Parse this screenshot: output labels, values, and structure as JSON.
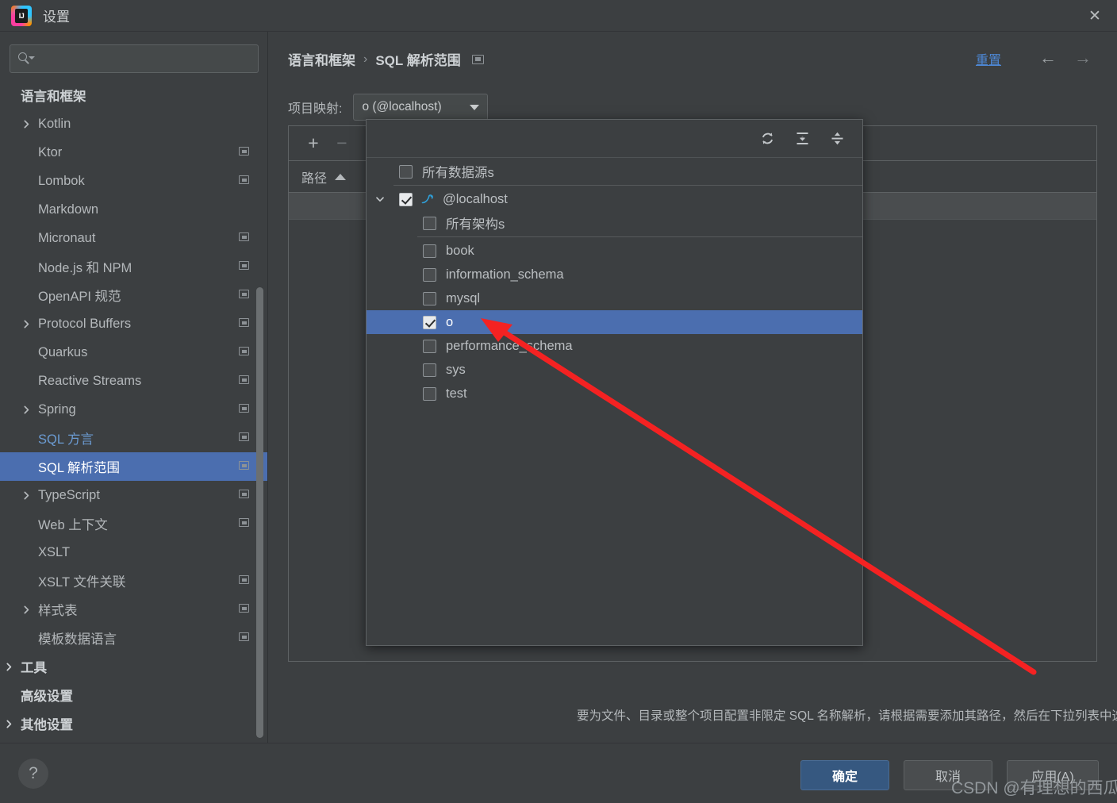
{
  "window": {
    "title": "设置",
    "logo_text": "IJ",
    "close_label": "✕"
  },
  "sidebar": {
    "search": {
      "value": "",
      "placeholder": ""
    },
    "items": [
      {
        "label": "语言和框架",
        "indent": 0,
        "heading": true,
        "chevron": "none",
        "badge": false,
        "selected": false
      },
      {
        "label": "Kotlin",
        "indent": 1,
        "heading": false,
        "chevron": "right",
        "badge": false,
        "selected": false
      },
      {
        "label": "Ktor",
        "indent": 1,
        "heading": false,
        "chevron": "none",
        "badge": true,
        "selected": false
      },
      {
        "label": "Lombok",
        "indent": 1,
        "heading": false,
        "chevron": "none",
        "badge": true,
        "selected": false
      },
      {
        "label": "Markdown",
        "indent": 1,
        "heading": false,
        "chevron": "none",
        "badge": false,
        "selected": false
      },
      {
        "label": "Micronaut",
        "indent": 1,
        "heading": false,
        "chevron": "none",
        "badge": true,
        "selected": false
      },
      {
        "label": "Node.js 和 NPM",
        "indent": 1,
        "heading": false,
        "chevron": "none",
        "badge": true,
        "selected": false
      },
      {
        "label": "OpenAPI 规范",
        "indent": 1,
        "heading": false,
        "chevron": "none",
        "badge": true,
        "selected": false
      },
      {
        "label": "Protocol Buffers",
        "indent": 1,
        "heading": false,
        "chevron": "right",
        "badge": true,
        "selected": false
      },
      {
        "label": "Quarkus",
        "indent": 1,
        "heading": false,
        "chevron": "none",
        "badge": true,
        "selected": false
      },
      {
        "label": "Reactive Streams",
        "indent": 1,
        "heading": false,
        "chevron": "none",
        "badge": true,
        "selected": false
      },
      {
        "label": "Spring",
        "indent": 1,
        "heading": false,
        "chevron": "right",
        "badge": true,
        "selected": false
      },
      {
        "label": "SQL 方言",
        "indent": 1,
        "heading": false,
        "chevron": "none",
        "badge": true,
        "selected": false,
        "blue": true
      },
      {
        "label": "SQL 解析范围",
        "indent": 1,
        "heading": false,
        "chevron": "none",
        "badge": true,
        "selected": true
      },
      {
        "label": "TypeScript",
        "indent": 1,
        "heading": false,
        "chevron": "right",
        "badge": true,
        "selected": false
      },
      {
        "label": "Web 上下文",
        "indent": 1,
        "heading": false,
        "chevron": "none",
        "badge": true,
        "selected": false
      },
      {
        "label": "XSLT",
        "indent": 1,
        "heading": false,
        "chevron": "none",
        "badge": false,
        "selected": false
      },
      {
        "label": "XSLT 文件关联",
        "indent": 1,
        "heading": false,
        "chevron": "none",
        "badge": true,
        "selected": false
      },
      {
        "label": "样式表",
        "indent": 1,
        "heading": false,
        "chevron": "right",
        "badge": true,
        "selected": false
      },
      {
        "label": "模板数据语言",
        "indent": 1,
        "heading": false,
        "chevron": "none",
        "badge": true,
        "selected": false
      },
      {
        "label": "工具",
        "indent": 0,
        "heading": true,
        "chevron": "right",
        "badge": false,
        "selected": false
      },
      {
        "label": "高级设置",
        "indent": 0,
        "heading": true,
        "chevron": "none",
        "badge": false,
        "selected": false
      },
      {
        "label": "其他设置",
        "indent": 0,
        "heading": true,
        "chevron": "right",
        "badge": false,
        "selected": false
      }
    ]
  },
  "header": {
    "breadcrumb_parent": "语言和框架",
    "breadcrumb_separator": "›",
    "breadcrumb_current": "SQL 解析范围",
    "reset_label": "重置",
    "back_arrow": "←",
    "forward_arrow": "→"
  },
  "mapping": {
    "label": "项目映射:",
    "selected_value": "o (@localhost)"
  },
  "table": {
    "add_label": "+",
    "remove_label": "−",
    "column_path": "路径",
    "sort_direction": "asc",
    "rows": []
  },
  "popup": {
    "toolbar": [
      {
        "name": "refresh-icon",
        "title": "刷新"
      },
      {
        "name": "expand-all-icon",
        "title": "全部展开"
      },
      {
        "name": "collapse-all-icon",
        "title": "全部折叠"
      }
    ],
    "rows": [
      {
        "label": "所有数据源s",
        "indent": 1,
        "checked": false,
        "chevron": "none",
        "icon": "none",
        "selected": false,
        "divider_after": true
      },
      {
        "label": "@localhost",
        "indent": 1,
        "checked": true,
        "chevron": "down",
        "icon": "mysql",
        "selected": false,
        "divider_after": false
      },
      {
        "label": "所有架构s",
        "indent": 2,
        "checked": false,
        "chevron": "none",
        "icon": "none",
        "selected": false,
        "divider_after": true
      },
      {
        "label": "book",
        "indent": 2,
        "checked": false,
        "chevron": "none",
        "icon": "none",
        "selected": false,
        "divider_after": false
      },
      {
        "label": "information_schema",
        "indent": 2,
        "checked": false,
        "chevron": "none",
        "icon": "none",
        "selected": false,
        "divider_after": false
      },
      {
        "label": "mysql",
        "indent": 2,
        "checked": false,
        "chevron": "none",
        "icon": "none",
        "selected": false,
        "divider_after": false
      },
      {
        "label": "o",
        "indent": 2,
        "checked": true,
        "chevron": "none",
        "icon": "none",
        "selected": true,
        "divider_after": false
      },
      {
        "label": "performance_schema",
        "indent": 2,
        "checked": false,
        "chevron": "none",
        "icon": "none",
        "selected": false,
        "divider_after": false
      },
      {
        "label": "sys",
        "indent": 2,
        "checked": false,
        "chevron": "none",
        "icon": "none",
        "selected": false,
        "divider_after": false
      },
      {
        "label": "test",
        "indent": 2,
        "checked": false,
        "chevron": "none",
        "icon": "none",
        "selected": false,
        "divider_after": false
      }
    ]
  },
  "description": "要为文件、目录或整个项目配置非限定 SQL 名称解析，请根据需要添加其路径，然后在下拉列表中选择所需的数据源、数据库和架构。",
  "footer": {
    "help_label": "?",
    "ok_label": "确定",
    "cancel_label": "取消",
    "apply_label": "应用(A)"
  },
  "watermark": "CSDN @有理想的西瓜",
  "colors": {
    "window_bg": "#3c3f41",
    "selection_blue": "#4b6eaf",
    "link_blue": "#4d87d4",
    "ok_button": "#365880",
    "annotation_red": "#f42222",
    "mysql_icon": "#2f9fd8"
  }
}
